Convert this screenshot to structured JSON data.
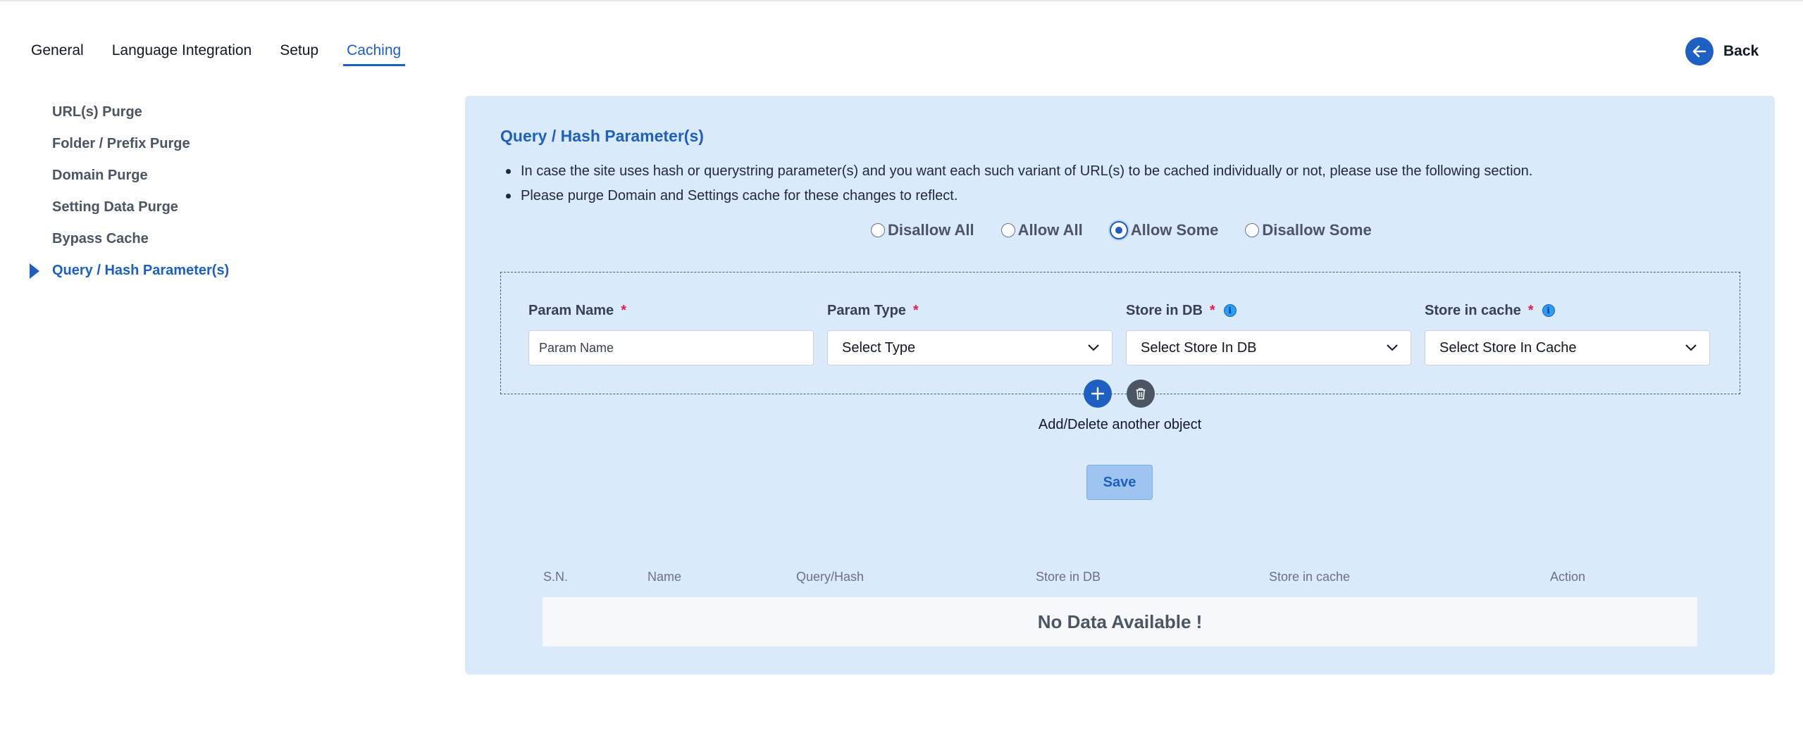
{
  "tabs": [
    {
      "label": "General"
    },
    {
      "label": "Language Integration"
    },
    {
      "label": "Setup"
    },
    {
      "label": "Caching"
    }
  ],
  "active_tab": "Caching",
  "back": {
    "label": "Back",
    "icon": "arrow-left-icon"
  },
  "sidebar": {
    "items": [
      {
        "label": "URL(s) Purge"
      },
      {
        "label": "Folder / Prefix Purge"
      },
      {
        "label": "Domain Purge"
      },
      {
        "label": "Setting Data Purge"
      },
      {
        "label": "Bypass Cache"
      },
      {
        "label": "Query / Hash Parameter(s)"
      }
    ],
    "active": "Query / Hash Parameter(s)"
  },
  "panel": {
    "title": "Query / Hash Parameter(s)",
    "bullets": [
      "In case the site uses hash or querystring parameter(s) and you want each such variant of URL(s) to be cached individually or not, please use the following section.",
      "Please purge Domain and Settings cache for these changes to reflect."
    ],
    "radios": [
      {
        "label": "Disallow All",
        "checked": false
      },
      {
        "label": "Allow All",
        "checked": false
      },
      {
        "label": "Allow Some",
        "checked": true
      },
      {
        "label": "Disallow Some",
        "checked": false
      }
    ],
    "fields": {
      "param_name": {
        "label": "Param Name",
        "required": "*",
        "placeholder": "Param Name",
        "value": ""
      },
      "param_type": {
        "label": "Param Type",
        "required": "*",
        "selected": "Select Type"
      },
      "store_db": {
        "label": "Store in DB",
        "required": "*",
        "selected": "Select Store In DB",
        "info_icon": "info-icon"
      },
      "store_cache": {
        "label": "Store in cache",
        "required": "*",
        "selected": "Select Store In Cache",
        "info_icon": "info-icon"
      }
    },
    "add_delete_label": "Add/Delete another object",
    "save_label": "Save",
    "table": {
      "headers": [
        "S.N.",
        "Name",
        "Query/Hash",
        "Store in DB",
        "Store in cache",
        "Action"
      ],
      "empty_text": "No Data Available !"
    }
  },
  "colors": {
    "accent": "#1d5fc2",
    "panel_bg": "#dbeafb",
    "required": "#e11d48"
  }
}
